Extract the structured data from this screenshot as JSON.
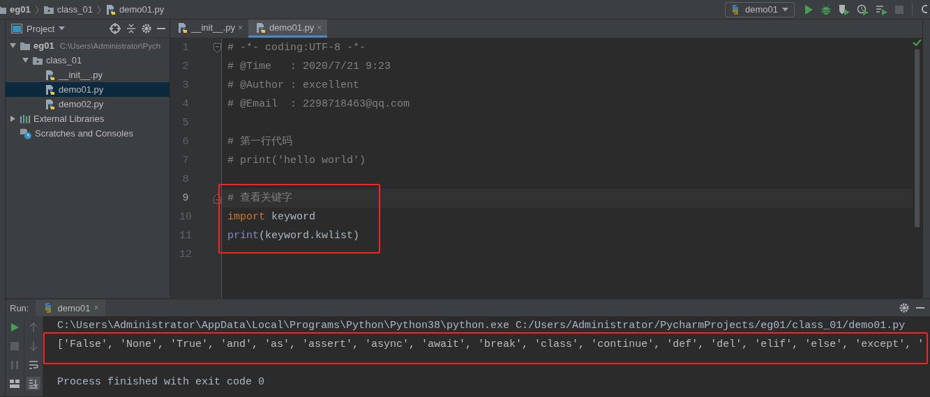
{
  "breadcrumbs": [
    {
      "label": "eg01",
      "kind": "folder"
    },
    {
      "label": "class_01",
      "kind": "package"
    },
    {
      "label": "demo01.py",
      "kind": "python"
    }
  ],
  "run_config": {
    "label": "demo01"
  },
  "project_panel": {
    "title": "Project",
    "tree": [
      {
        "label": "eg01",
        "path": "C:\\Users\\Administrator\\Pych",
        "kind": "folder",
        "expanded": true,
        "selected": false,
        "children": [
          {
            "label": "class_01",
            "kind": "package",
            "expanded": true,
            "selected": false,
            "children": [
              {
                "label": "__init__.py",
                "kind": "python",
                "selected": false
              },
              {
                "label": "demo01.py",
                "kind": "python",
                "selected": true
              },
              {
                "label": "demo02.py",
                "kind": "python",
                "selected": false
              }
            ]
          }
        ]
      },
      {
        "label": "External Libraries",
        "kind": "libraries",
        "expanded": false,
        "selected": false
      },
      {
        "label": "Scratches and Consoles",
        "kind": "scratches",
        "selected": false
      }
    ]
  },
  "editor": {
    "tabs": [
      {
        "label": "__init__.py",
        "close": "×",
        "selected": false
      },
      {
        "label": "demo01.py",
        "close": "×",
        "selected": true
      }
    ],
    "lines": [
      {
        "number": "1",
        "current": false,
        "highlighted": false,
        "fold_start": true,
        "segments": [
          {
            "kind": "comment",
            "text": "# -*- coding:UTF-8 -*-"
          }
        ]
      },
      {
        "number": "2",
        "current": false,
        "highlighted": false,
        "segments": [
          {
            "kind": "comment",
            "text": "# @Time   : 2020/7/21 9:23"
          }
        ]
      },
      {
        "number": "3",
        "current": false,
        "highlighted": false,
        "segments": [
          {
            "kind": "comment",
            "text": "# @Author : excellent"
          }
        ]
      },
      {
        "number": "4",
        "current": false,
        "highlighted": false,
        "segments": [
          {
            "kind": "comment",
            "text": "# @Email  : 2298718463@qq.com"
          }
        ]
      },
      {
        "number": "5",
        "current": false,
        "highlighted": false
      },
      {
        "number": "6",
        "current": false,
        "highlighted": false,
        "segments": [
          {
            "kind": "comment",
            "text": "# 第一行代码"
          }
        ]
      },
      {
        "number": "7",
        "current": false,
        "highlighted": false,
        "segments": [
          {
            "kind": "comment",
            "text": "# print('hello world')"
          }
        ]
      },
      {
        "number": "8",
        "current": false,
        "highlighted": false
      },
      {
        "number": "9",
        "current": true,
        "highlighted": true,
        "fold_end": true,
        "segments": [
          {
            "kind": "comment",
            "text": "# 查看关键字"
          }
        ]
      },
      {
        "number": "10",
        "current": false,
        "highlighted": true,
        "segments": [
          {
            "kind": "keyword",
            "text": "import"
          },
          {
            "kind": "plain",
            "text": " keyword"
          }
        ]
      },
      {
        "number": "11",
        "current": false,
        "highlighted": true,
        "segments": [
          {
            "kind": "builtin",
            "text": "print"
          },
          {
            "kind": "plain",
            "text": "(keyword.kwlist)"
          }
        ]
      },
      {
        "number": "12",
        "current": false,
        "highlighted": false
      }
    ]
  },
  "run_panel": {
    "label": "Run:",
    "tabs": [
      {
        "label": "demo01",
        "close": "×",
        "selected": true
      }
    ],
    "console": [
      {
        "kind": "command",
        "highlighted": false,
        "text": "C:\\Users\\Administrator\\AppData\\Local\\Programs\\Python\\Python38\\python.exe C:/Users/Administrator/PycharmProjects/eg01/class_01/demo01.py"
      },
      {
        "kind": "output",
        "highlighted": true,
        "text": "['False', 'None', 'True', 'and', 'as', 'assert', 'async', 'await', 'break', 'class', 'continue', 'def', 'del', 'elif', 'else', 'except', '"
      },
      {
        "kind": "blank"
      },
      {
        "kind": "status",
        "highlighted": false,
        "text": "Process finished with exit code 0"
      }
    ]
  }
}
